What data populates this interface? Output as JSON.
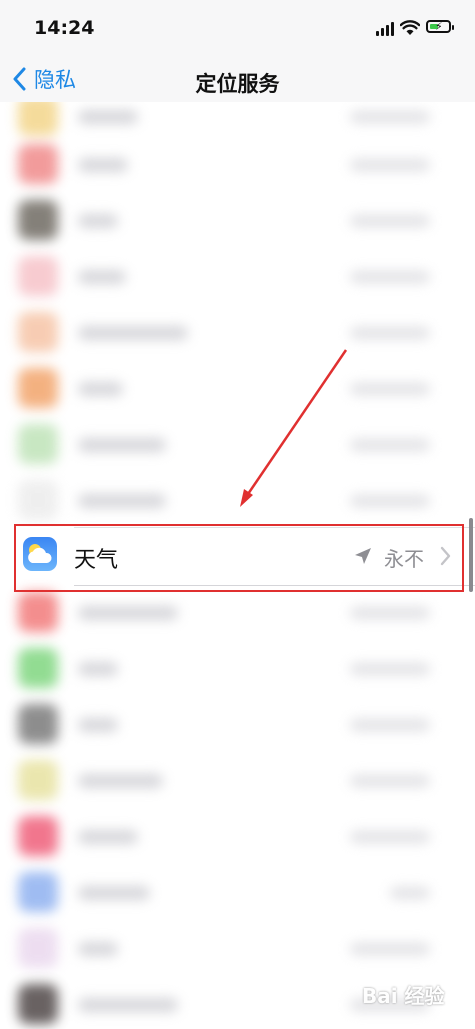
{
  "status": {
    "time": "14:24"
  },
  "nav": {
    "back_label": "隐私",
    "title": "定位服务"
  },
  "highlighted_row": {
    "label": "天气",
    "value": "永不"
  },
  "watermark": {
    "text": "Bai 经验"
  },
  "colors": {
    "accent": "#1e88e5",
    "highlight": "#e03030"
  }
}
